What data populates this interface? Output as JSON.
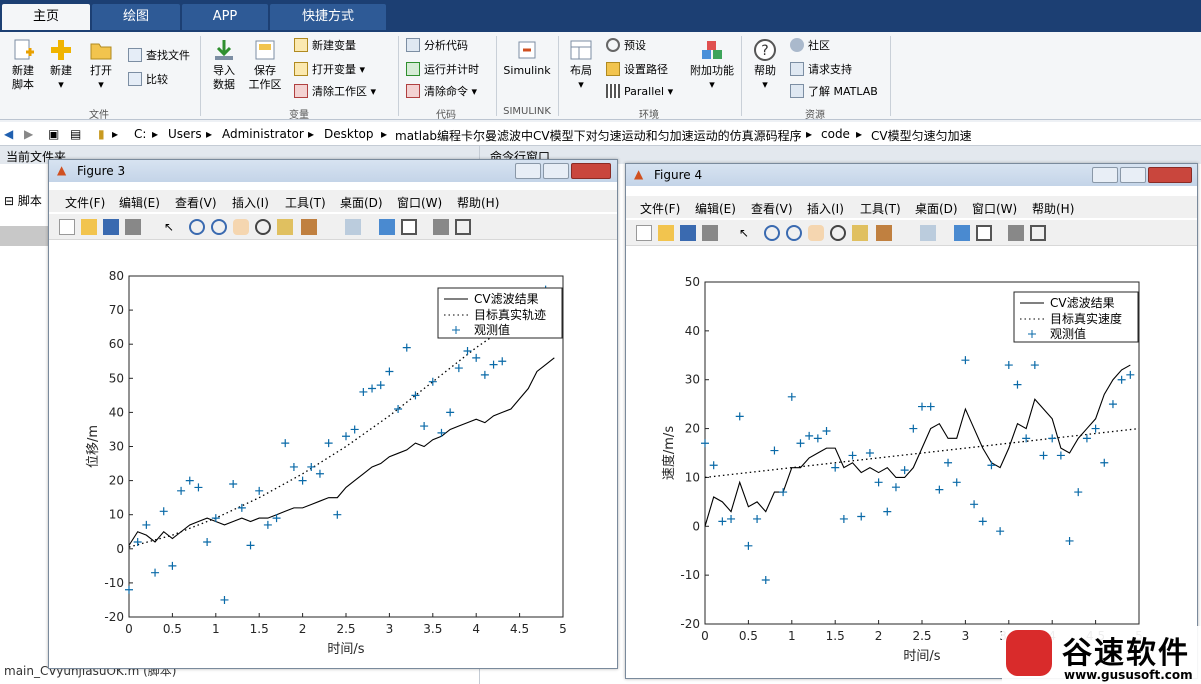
{
  "tabs": [
    "主页",
    "绘图",
    "APP",
    "快捷方式"
  ],
  "ribbon": {
    "new_script": [
      "新建",
      "脚本"
    ],
    "new": "新建",
    "open": "打开",
    "find_files": "查找文件",
    "compare": "比较",
    "import": [
      "导入",
      "数据"
    ],
    "save_ws": [
      "保存",
      "工作区"
    ],
    "new_var": "新建变量",
    "open_var": "打开变量",
    "clear_ws": "清除工作区",
    "analyze": "分析代码",
    "run_time": "运行并计时",
    "clear_cmd": "清除命令",
    "simulink": "Simulink",
    "layout": "布局",
    "prefs": "预设",
    "set_path": "设置路径",
    "parallel": "Parallel",
    "addons": "附加功能",
    "help": "帮助",
    "community": "社区",
    "support": "请求支持",
    "learn": "了解 MATLAB",
    "groups": [
      "文件",
      "变量",
      "代码",
      "SIMULINK",
      "环境",
      "资源"
    ]
  },
  "address": {
    "path": [
      "C:",
      "Users",
      "Administrator",
      "Desktop",
      "matlab编程卡尔曼滤波中CV模型下对匀速运动和匀加速运动的仿真源码程序",
      "code",
      "CV模型匀速匀加速"
    ]
  },
  "left_panel": {
    "title": "当前文件夹",
    "tree_label": "脚本",
    "footer": "main_CVyunjiasuOK.m (脚本)"
  },
  "right_panel": {
    "title": "命令行窗口"
  },
  "menu": [
    "文件(F)",
    "编辑(E)",
    "查看(V)",
    "插入(I)",
    "工具(T)",
    "桌面(D)",
    "窗口(W)",
    "帮助(H)"
  ],
  "fig3": {
    "title": "Figure 3"
  },
  "fig4": {
    "title": "Figure 4"
  },
  "watermark": {
    "brand": "谷速软件",
    "url": "www.gususoft.com"
  },
  "chart_data": [
    {
      "type": "line",
      "xlabel": "时间/s",
      "ylabel": "位移/m",
      "xlim": [
        0,
        5
      ],
      "ylim": [
        -20,
        80
      ],
      "xticks": [
        0,
        0.5,
        1,
        1.5,
        2,
        2.5,
        3,
        3.5,
        4,
        4.5,
        5
      ],
      "yticks": [
        -20,
        -10,
        0,
        10,
        20,
        30,
        40,
        50,
        60,
        70,
        80
      ],
      "legend": [
        "CV滤波结果",
        "目标真实轨迹",
        "观测值"
      ],
      "legend_position": "top-right",
      "filtered": {
        "x": [
          0,
          0.1,
          0.2,
          0.3,
          0.4,
          0.5,
          0.6,
          0.7,
          0.8,
          0.9,
          1,
          1.1,
          1.2,
          1.3,
          1.4,
          1.5,
          1.6,
          1.7,
          1.8,
          1.9,
          2,
          2.1,
          2.2,
          2.3,
          2.4,
          2.5,
          2.6,
          2.7,
          2.8,
          2.9,
          3,
          3.1,
          3.2,
          3.3,
          3.4,
          3.5,
          3.6,
          3.7,
          3.8,
          3.9,
          4,
          4.1,
          4.2,
          4.3,
          4.4,
          4.5,
          4.6,
          4.7,
          4.8,
          4.9
        ],
        "y": [
          1,
          5,
          4,
          2,
          5,
          3,
          5,
          7,
          8,
          9,
          8,
          7,
          8,
          9,
          8,
          9,
          9,
          10,
          11,
          12,
          12,
          13,
          14,
          15,
          15,
          18,
          20,
          22,
          24,
          25,
          27,
          28,
          29,
          31,
          30,
          32,
          33,
          35,
          36,
          37,
          38,
          37,
          39,
          40,
          41,
          44,
          47,
          52,
          54,
          56
        ]
      },
      "truth": {
        "x": [
          0,
          0.5,
          1,
          1.5,
          2,
          2.5,
          3,
          3.5,
          4,
          4.4
        ],
        "y": [
          0.5,
          4,
          9,
          15,
          22,
          30,
          39,
          49,
          59,
          66
        ]
      },
      "observed": {
        "x": [
          0,
          0.1,
          0.2,
          0.3,
          0.4,
          0.5,
          0.6,
          0.7,
          0.8,
          0.9,
          1,
          1.1,
          1.2,
          1.3,
          1.4,
          1.5,
          1.6,
          1.7,
          1.8,
          1.9,
          2,
          2.1,
          2.2,
          2.3,
          2.4,
          2.5,
          2.6,
          2.7,
          2.8,
          2.9,
          3,
          3.1,
          3.2,
          3.3,
          3.4,
          3.5,
          3.6,
          3.7,
          3.8,
          3.9,
          4,
          4.1,
          4.2,
          4.3,
          4.4,
          4.5,
          4.6,
          4.7,
          4.8,
          4.9
        ],
        "y": [
          -12,
          2,
          7,
          -7,
          11,
          -5,
          17,
          20,
          18,
          2,
          9,
          -15,
          19,
          12,
          1,
          17,
          7,
          9,
          31,
          24,
          20,
          24,
          22,
          31,
          10,
          33,
          35,
          46,
          47,
          48,
          52,
          41,
          59,
          45,
          36,
          49,
          34,
          40,
          53,
          58,
          56,
          51,
          54,
          55,
          65,
          66,
          67,
          68,
          76,
          71
        ]
      }
    },
    {
      "type": "line",
      "xlabel": "时间/s",
      "ylabel": "速度/m/s",
      "xlim": [
        0,
        5
      ],
      "ylim": [
        -20,
        50
      ],
      "xticks": [
        0,
        0.5,
        1,
        1.5,
        2,
        2.5,
        3,
        3.5,
        4,
        4.5,
        5
      ],
      "yticks": [
        -20,
        -10,
        0,
        10,
        20,
        30,
        40,
        50
      ],
      "legend": [
        "CV滤波结果",
        "目标真实速度",
        "观测值"
      ],
      "legend_position": "top-right",
      "filtered": {
        "x": [
          0,
          0.1,
          0.2,
          0.3,
          0.4,
          0.5,
          0.6,
          0.7,
          0.8,
          0.9,
          1,
          1.1,
          1.2,
          1.3,
          1.4,
          1.5,
          1.6,
          1.7,
          1.8,
          1.9,
          2,
          2.1,
          2.2,
          2.3,
          2.4,
          2.5,
          2.6,
          2.7,
          2.8,
          2.9,
          3,
          3.1,
          3.2,
          3.3,
          3.4,
          3.5,
          3.6,
          3.7,
          3.8,
          3.9,
          4,
          4.1,
          4.2,
          4.3,
          4.4,
          4.5,
          4.6,
          4.7,
          4.8,
          4.9
        ],
        "y": [
          0,
          6,
          5,
          3,
          9,
          4,
          5,
          3,
          7,
          7,
          12,
          12,
          14,
          15,
          16,
          16,
          12,
          13,
          11,
          12,
          11,
          12,
          10,
          10,
          12,
          16,
          20,
          21,
          18,
          18,
          24,
          20,
          16,
          13,
          12,
          16,
          21,
          20,
          26,
          24,
          22,
          16,
          15,
          18,
          20,
          22,
          27,
          30,
          32,
          33
        ]
      },
      "truth": {
        "x": [
          0,
          5
        ],
        "y": [
          10,
          20
        ]
      },
      "observed": {
        "x": [
          0,
          0.1,
          0.2,
          0.3,
          0.4,
          0.5,
          0.6,
          0.7,
          0.8,
          0.9,
          1,
          1.1,
          1.2,
          1.3,
          1.4,
          1.5,
          1.6,
          1.7,
          1.8,
          1.9,
          2,
          2.1,
          2.2,
          2.3,
          2.4,
          2.5,
          2.6,
          2.7,
          2.8,
          2.9,
          3,
          3.1,
          3.2,
          3.3,
          3.4,
          3.5,
          3.6,
          3.7,
          3.8,
          3.9,
          4,
          4.1,
          4.2,
          4.3,
          4.4,
          4.5,
          4.6,
          4.7,
          4.8,
          4.9
        ],
        "y": [
          17,
          12.5,
          1,
          1.5,
          22.5,
          -4,
          1.5,
          -11,
          15.5,
          7,
          26.5,
          17,
          18.5,
          18,
          19.5,
          12,
          1.5,
          14.5,
          2,
          15,
          9,
          3,
          8,
          11.5,
          20,
          24.5,
          24.5,
          7.5,
          13,
          9,
          34,
          4.5,
          1,
          12.5,
          -1,
          33,
          29,
          18,
          33,
          14.5,
          18,
          14.5,
          -3,
          7,
          18,
          20,
          13,
          25,
          30,
          31
        ]
      }
    }
  ]
}
